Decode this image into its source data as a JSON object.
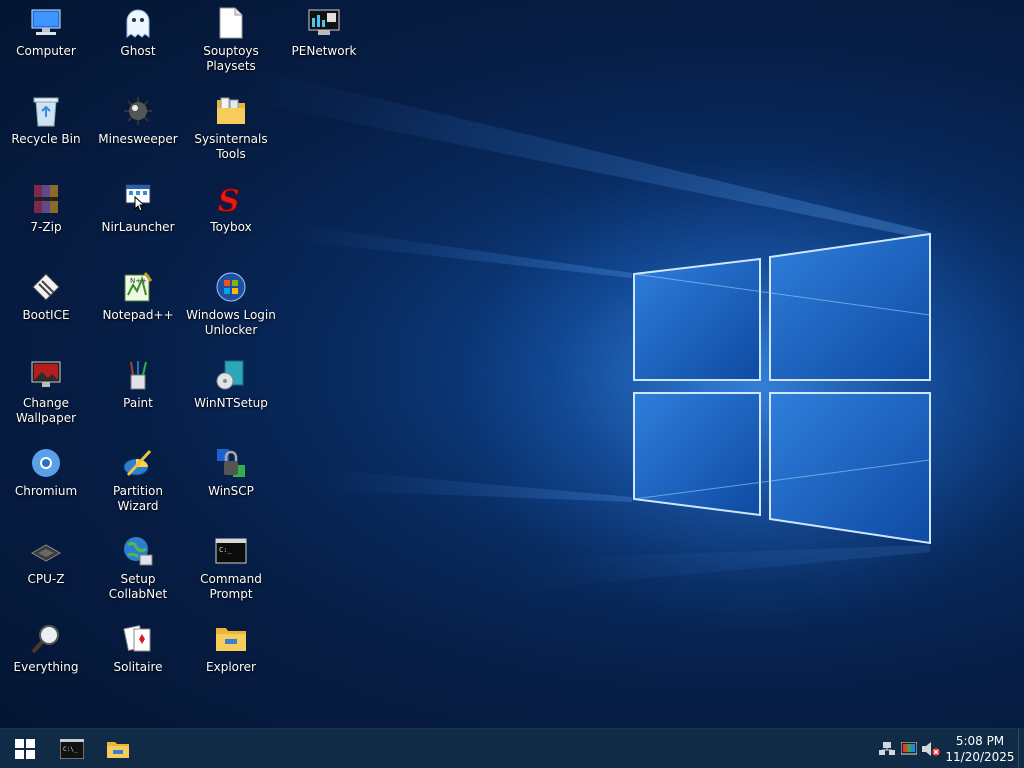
{
  "desktop": {
    "icons": [
      {
        "label": "Computer",
        "icon": "computer-icon"
      },
      {
        "label": "Ghost",
        "icon": "ghost-icon"
      },
      {
        "label": "Souptoys\nPlaysets",
        "icon": "document-icon"
      },
      {
        "label": "PENetwork",
        "icon": "network-monitor-icon"
      },
      {
        "label": "Recycle Bin",
        "icon": "recycle-bin-icon"
      },
      {
        "label": "Minesweeper",
        "icon": "mine-icon"
      },
      {
        "label": "Sysinternals\nTools",
        "icon": "folder-tools-icon"
      },
      {
        "label": "7-Zip",
        "icon": "archive-icon"
      },
      {
        "label": "NirLauncher",
        "icon": "launcher-icon"
      },
      {
        "label": "Toybox",
        "icon": "toybox-s-icon"
      },
      {
        "label": "BootICE",
        "icon": "bootice-icon"
      },
      {
        "label": "Notepad++",
        "icon": "notepad-plus-icon"
      },
      {
        "label": "Windows Login\nUnlocker",
        "icon": "windows-orb-icon"
      },
      {
        "label": "Change\nWallpaper",
        "icon": "wallpaper-icon"
      },
      {
        "label": "Paint",
        "icon": "paint-brushes-icon"
      },
      {
        "label": "WinNTSetup",
        "icon": "winntsetup-icon"
      },
      {
        "label": "Chromium",
        "icon": "chromium-icon"
      },
      {
        "label": "Partition Wizard",
        "icon": "partition-wizard-icon"
      },
      {
        "label": "WinSCP",
        "icon": "winscp-icon"
      },
      {
        "label": "CPU-Z",
        "icon": "cpu-chip-icon"
      },
      {
        "label": "Setup CollabNet",
        "icon": "globe-setup-icon"
      },
      {
        "label": "Command\nPrompt",
        "icon": "terminal-icon"
      },
      {
        "label": "Everything",
        "icon": "magnifier-icon"
      },
      {
        "label": "Solitaire",
        "icon": "cards-icon"
      },
      {
        "label": "Explorer",
        "icon": "folder-icon"
      }
    ]
  },
  "taskbar": {
    "start_icon": "windows-logo-icon",
    "pinned": [
      {
        "name": "command-prompt",
        "icon": "terminal-icon"
      },
      {
        "name": "file-explorer",
        "icon": "folder-icon"
      }
    ],
    "tray": {
      "network_icon": "network-icon",
      "color_icon": "color-palette-icon",
      "volume_icon": "volume-muted-icon",
      "time": "5:08 PM",
      "date": "11/20/2025"
    }
  },
  "colors": {
    "taskbar": "#0f2b45",
    "wallpaper_dark": "#041531",
    "wallpaper_light": "#1c5fb0",
    "window_pane": "#2f7fdc"
  }
}
